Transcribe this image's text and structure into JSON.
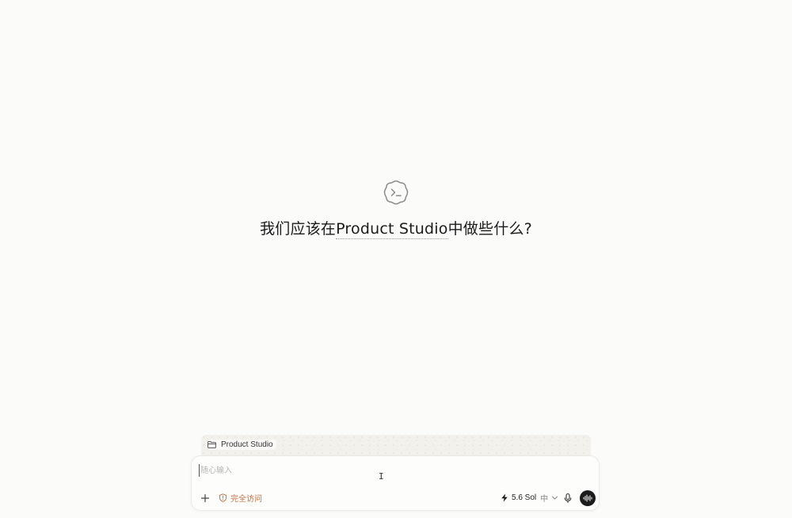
{
  "hero": {
    "icon": "terminal-cloud-icon",
    "title_prefix": "我们应该在",
    "project_name": "Product Studio",
    "title_suffix": "中做些什么?"
  },
  "project_chip": {
    "icon": "folder-icon",
    "label": "Product Studio"
  },
  "composer": {
    "placeholder": "随心输入",
    "value": "",
    "add_icon": "plus-icon",
    "access": {
      "icon": "shield-alert-icon",
      "label": "完全访问",
      "color": "#c3743f"
    },
    "model": {
      "icon": "lightning-icon",
      "name": "5.6 Sol",
      "level": "中",
      "chevron": "chevron-down-icon"
    },
    "mic_icon": "microphone-icon",
    "voice_icon": "waveform-icon"
  },
  "colors": {
    "background": "#fbfbfa",
    "accent": "#c3743f",
    "voice_button": "#1c1c1c"
  }
}
